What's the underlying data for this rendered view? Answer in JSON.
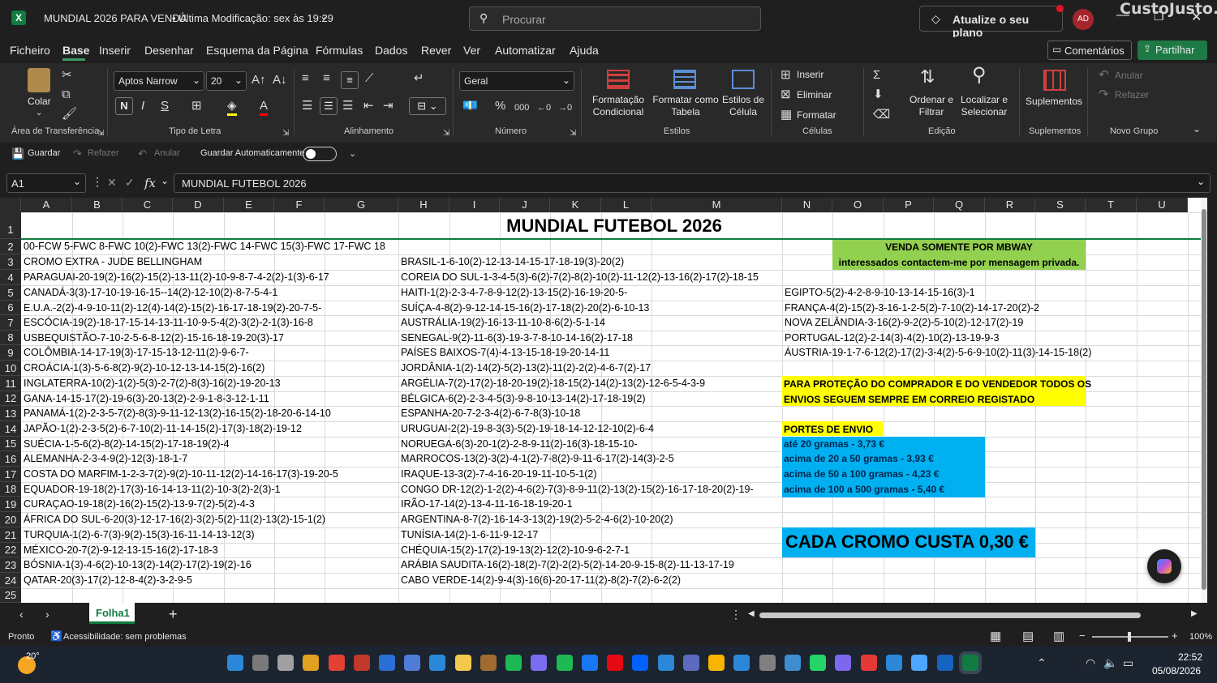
{
  "titlebar": {
    "title": "MUNDIAL 2026 PARA VENDA",
    "modified": "• Última Modificação: sex às 19:29",
    "search_placeholder": "Procurar",
    "upgrade": "Atualize o seu plano",
    "avatar": "AD",
    "watermark": "CustoJusto.pt"
  },
  "menu": [
    "Ficheiro",
    "Base",
    "Inserir",
    "Desenhar",
    "Esquema da Página",
    "Fórmulas",
    "Dados",
    "Rever",
    "Ver",
    "Automatizar",
    "Ajuda"
  ],
  "menu_right": {
    "comments": "Comentários",
    "share": "Partilhar"
  },
  "ribbon": {
    "paste": "Colar",
    "clipboard_group": "Área de Transferência",
    "font_name": "Aptos Narrow",
    "font_size": "20",
    "bold": "N",
    "italic": "I",
    "underline": "S",
    "font_group": "Tipo de Letra",
    "align_group": "Alinhamento",
    "number_format": "Geral",
    "number_group": "Número",
    "cond_format": "Formatação\nCondicional",
    "format_table": "Formatar como\nTabela",
    "cell_styles": "Estilos de\nCélula",
    "styles_group": "Estilos",
    "insert": "Inserir",
    "delete": "Eliminar",
    "format": "Formatar",
    "cells_group": "Células",
    "sort_filter": "Ordenar e\nFiltrar",
    "find_select": "Localizar e\nSelecionar",
    "edit_group": "Edição",
    "addins": "Suplementos",
    "addins_group": "Suplementos",
    "undo": "Anular",
    "redo": "Refazer",
    "new_group": "Novo Grupo"
  },
  "qat": {
    "save": "Guardar",
    "redo": "Refazer",
    "undo": "Anular",
    "autosave": "Guardar Automaticamente"
  },
  "formula": {
    "namebox": "A1",
    "fx": "fx",
    "content": "MUNDIAL FUTEBOL 2026"
  },
  "columns": [
    "A",
    "B",
    "C",
    "D",
    "E",
    "F",
    "G",
    "H",
    "I",
    "J",
    "K",
    "L",
    "M",
    "N",
    "O",
    "P",
    "Q",
    "R",
    "S",
    "T",
    "U"
  ],
  "rows": [
    "1",
    "2",
    "3",
    "4",
    "5",
    "6",
    "7",
    "8",
    "9",
    "10",
    "11",
    "12",
    "13",
    "14",
    "15",
    "16",
    "17",
    "18",
    "19",
    "20",
    "21",
    "22",
    "23",
    "24",
    "25"
  ],
  "sheet": {
    "title": "MUNDIAL FUTEBOL 2026",
    "colA": [
      "00-FCW 5-FWC 8-FWC 10(2)-FWC 13(2)-FWC 14-FWC 15(3)-FWC 17-FWC 18",
      "CROMO EXTRA - JUDE BELLINGHAM",
      "PARAGUAI-20-19(2)-16(2)-15(2)-13-11(2)-10-9-8-7-4-2(2)-1(3)-6-17",
      "CANADÁ-3(3)-17-10-19-16-15--14(2)-12-10(2)-8-7-5-4-1",
      "E.U.A.-2(2)-4-9-10-11(2)-12(4)-14(2)-15(2)-16-17-18-19(2)-20-7-5-",
      "ESCÓCIA-19(2)-18-17-15-14-13-11-10-9-5-4(2)-3(2)-2-1(3)-16-8",
      "USBEQUISTÃO-7-10-2-5-6-8-12(2)-15-16-18-19-20(3)-17",
      "COLÔMBIA-14-17-19(3)-17-15-13-12-11(2)-9-6-7-",
      "CROÁCIA-1(3)-5-6-8(2)-9(2)-10-12-13-14-15(2)-16(2)",
      "INGLATERRA-10(2)-1(2)-5(3)-2-7(2)-8(3)-16(2)-19-20-13",
      "GANA-14-15-17(2)-19-6(3)-20-13(2)-2-9-1-8-3-12-1-11",
      "PANAMÁ-1(2)-2-3-5-7(2)-8(3)-9-11-12-13(2)-16-15(2)-18-20-6-14-10",
      "JAPÃO-1(2)-2-3-5(2)-6-7-10(2)-11-14-15(2)-17(3)-18(2)-19-12",
      "SUÉCIA-1-5-6(2)-8(2)-14-15(2)-17-18-19(2)-4",
      "ALEMANHA-2-3-4-9(2)-12(3)-18-1-7",
      "COSTA DO MARFIM-1-2-3-7(2)-9(2)-10-11-12(2)-14-16-17(3)-19-20-5",
      "EQUADOR-19-18(2)-17(3)-16-14-13-11(2)-10-3(2)-2(3)-1",
      "CURAÇAO-19-18(2)-16(2)-15(2)-13-9-7(2)-5(2)-4-3",
      "ÁFRICA DO SUL-6-20(3)-12-17-16(2)-3(2)-5(2)-11(2)-13(2)-15-1(2)",
      "TURQUIA-1(2)-6-7(3)-9(2)-15(3)-16-11-14-13-12(3)",
      "MÉXICO-20-7(2)-9-12-13-15-16(2)-17-18-3",
      "BÓSNIA-1(3)-4-6(2)-10-13(2)-14(2)-17(2)-19(2)-16",
      "QATAR-20(3)-17(2)-12-8-4(2)-3-2-9-5"
    ],
    "colH": [
      "BRASIL-1-6-10(2)-12-13-14-15-17-18-19(3)-20(2)",
      "COREIA DO SUL-1-3-4-5(3)-6(2)-7(2)-8(2)-10(2)-11-12(2)-13-16(2)-17(2)-18-15",
      "HAITI-1(2)-2-3-4-7-8-9-12(2)-13-15(2)-16-19-20-5-",
      "SUÍÇA-4-8(2)-9-12-14-15-16(2)-17-18(2)-20(2)-6-10-13",
      "AUSTRÁLIA-19(2)-16-13-11-10-8-6(2)-5-1-14",
      "SENEGAL-9(2)-11-6(3)-19-3-7-8-10-14-16(2)-17-18",
      "PAÍSES BAIXOS-7(4)-4-13-15-18-19-20-14-11",
      "JORDÂNIA-1(2)-14(2)-5(2)-13(2)-11(2)-2(2)-4-6-7(2)-17",
      "ARGÉLIA-7(2)-17(2)-18-20-19(2)-18-15(2)-14(2)-13(2)-12-6-5-4-3-9",
      "BÉLGICA-6(2)-2-3-4-5(3)-9-8-10-13-14(2)-17-18-19(2)",
      "ESPANHA-20-7-2-3-4(2)-6-7-8(3)-10-18",
      "URUGUAI-2(2)-19-8-3(3)-5(2)-19-18-14-12-12-10(2)-6-4",
      "NORUEGA-6(3)-20-1(2)-2-8-9-11(2)-16(3)-18-15-10-",
      "MARROCOS-13(2)-3(2)-4-1(2)-7-8(2)-9-11-6-17(2)-14(3)-2-5",
      "IRAQUE-13-3(2)-7-4-16-20-19-11-10-5-1(2)",
      "CONGO DR-12(2)-1-2(2)-4-6(2)-7(3)-8-9-11(2)-13(2)-15(2)-16-17-18-20(2)-19-",
      "IRÃO-17-14(2)-13-4-11-16-18-19-20-1",
      "ARGENTINA-8-7(2)-16-14-3-13(2)-19(2)-5-2-4-6(2)-10-20(2)",
      "TUNÍSIA-14(2)-1-6-11-9-12-17",
      "CHÉQUIA-15(2)-17(2)-19-13(2)-12(2)-10-9-6-2-7-1",
      "ARÁBIA SAUDITA-16(2)-18(2)-7(2)-2(2)-5(2)-14-20-9-15-8(2)-11-13-17-19",
      "CABO VERDE-14(2)-9-4(3)-16(6)-20-17-11(2)-8(2)-7(2)-6-2(2)"
    ],
    "colN": [
      "EGIPTO-5(2)-4-2-8-9-10-13-14-15-16(3)-1",
      "FRANÇA-4(2)-15(2)-3-16-1-2-5(2)-7-10(2)-14-17-20(2)-2",
      "NOVA ZELÂNDIA-3-16(2)-9-2(2)-5-10(2)-12-17(2)-19",
      "PORTUGAL-12(2)-2-14(3)-4(2)-10(2)-13-19-9-3",
      "ÁUSTRIA-19-1-7-6-12(2)-17(2)-3-4(2)-5-6-9-10(2)-11(3)-14-15-18(2)"
    ],
    "mbway_1": "VENDA SOMENTE POR MBWAY",
    "mbway_2": "interessados contactem-me por mensagem privada.",
    "protect_1": "PARA PROTEÇÃO DO COMPRADOR E DO VENDEDOR TODOS OS",
    "protect_2": "ENVIOS SEGUEM SEMPRE EM CORREIO REGISTADO",
    "portes": "PORTES DE ENVIO",
    "prices": [
      "até 20 gramas - 3,73 €",
      "acima de 20 a 50 gramas - 3,93 €",
      "acima de 50 a 100 gramas - 4,23 €",
      "acima de 100 a 500 gramas - 5,40 €"
    ],
    "cromo": "CADA CROMO CUSTA 0,30 €"
  },
  "sheet_tab": "Folha1",
  "status": {
    "ready": "Pronto",
    "accessibility": "Acessibilidade: sem problemas",
    "zoom": "100%"
  },
  "taskbar": {
    "weather": "20°",
    "time": "22:52",
    "date": "05/08/2026"
  },
  "colors": {
    "green": "#92d050",
    "yellow": "#ffff00",
    "blue": "#00b0f0",
    "accent": "#107c41"
  }
}
